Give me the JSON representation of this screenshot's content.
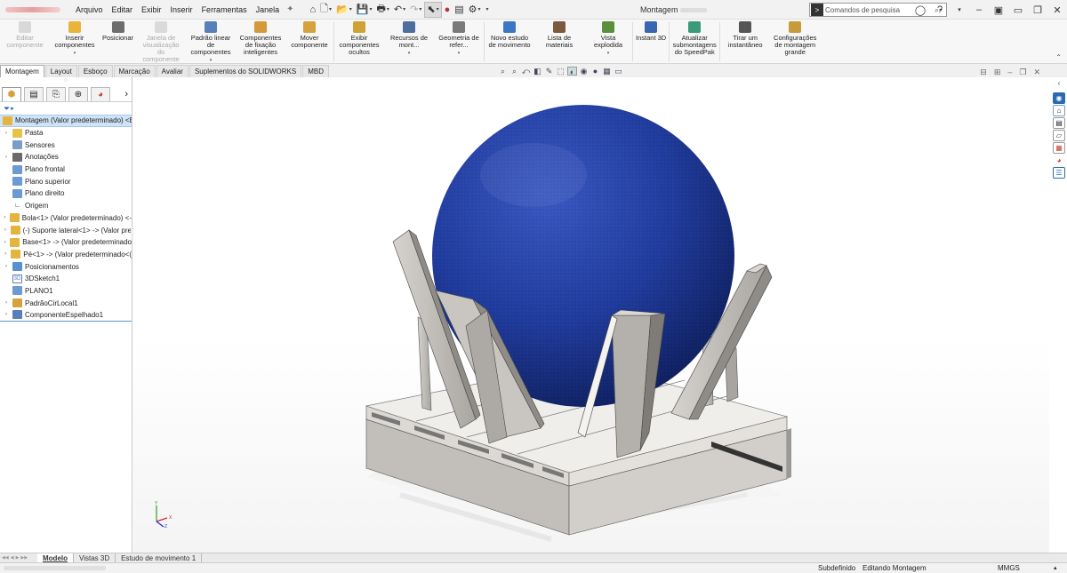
{
  "titlebar": {
    "menu": [
      "Arquivo",
      "Editar",
      "Exibir",
      "Inserir",
      "Ferramentas",
      "Janela"
    ],
    "doc_title": "Montagem",
    "search_placeholder": "Comandos de pesquisa"
  },
  "ribbon": {
    "buttons": [
      {
        "label": "Editar componente",
        "disabled": true,
        "color": "#b9b9b9"
      },
      {
        "label": "Inserir componentes",
        "disabled": false,
        "color": "#e8b43a"
      },
      {
        "label": "Posicionar",
        "disabled": false,
        "color": "#6d6d6d"
      },
      {
        "label": "Janela de visualização do componente",
        "disabled": true,
        "color": "#bdbdbd"
      },
      {
        "label": "Padrão linear de componentes",
        "disabled": false,
        "color": "#5a7fb8"
      },
      {
        "label": "Componentes de fixação inteligentes",
        "disabled": false,
        "color": "#d39a3a"
      },
      {
        "label": "Mover componente",
        "disabled": false,
        "color": "#d6a23d"
      },
      {
        "label": "Exibir componentes ocultos",
        "disabled": false,
        "color": "#cfa236"
      },
      {
        "label": "Recursos de mont...",
        "disabled": false,
        "color": "#4d6f9e"
      },
      {
        "label": "Geometria de refer...",
        "disabled": false,
        "color": "#7a7a7a"
      },
      {
        "label": "Novo estudo de movimento",
        "disabled": false,
        "color": "#3c77c4"
      },
      {
        "label": "Lista de materiais",
        "disabled": false,
        "color": "#7d5a3c"
      },
      {
        "label": "Vista explodida",
        "disabled": false,
        "color": "#5a8f3c"
      },
      {
        "label": "Instant 3D",
        "disabled": false,
        "color": "#3a66b0"
      },
      {
        "label": "Atualizar submontagens do SpeedPak",
        "disabled": false,
        "color": "#3a9a7a"
      },
      {
        "label": "Tirar um instantâneo",
        "disabled": false,
        "color": "#555555"
      },
      {
        "label": "Configurações de montagem grande",
        "disabled": false,
        "color": "#c79b3b"
      }
    ]
  },
  "tabs": [
    "Montagem",
    "Layout",
    "Esboço",
    "Marcação",
    "Avaliar",
    "Suplementos do SOLIDWORKS",
    "MBD"
  ],
  "active_tab": "Montagem",
  "tree": {
    "root": "Montagem (Valor predeterminado) <Es",
    "items": [
      {
        "label": "Pasta",
        "exp": true,
        "icon": "folder-icon",
        "color": "#e6c34a"
      },
      {
        "label": "Sensores",
        "exp": false,
        "icon": "sensor-icon",
        "color": "#7a9ec8"
      },
      {
        "label": "Anotações",
        "exp": true,
        "icon": "annotation-icon",
        "color": "#6a6a6a"
      },
      {
        "label": "Plano frontal",
        "exp": false,
        "icon": "plane-icon",
        "color": "#6b9bd2"
      },
      {
        "label": "Plano superior",
        "exp": false,
        "icon": "plane-icon",
        "color": "#6b9bd2"
      },
      {
        "label": "Plano direito",
        "exp": false,
        "icon": "plane-icon",
        "color": "#6b9bd2"
      },
      {
        "label": "Origem",
        "exp": false,
        "icon": "origin-icon",
        "color": "#333333"
      },
      {
        "label": "Bola<1> (Valor predeterminado) <-",
        "exp": true,
        "icon": "part-icon",
        "color": "#e3b53e"
      },
      {
        "label": "(-) Suporte lateral<1> -> (Valor pre",
        "exp": true,
        "icon": "part-icon",
        "color": "#e3b53e"
      },
      {
        "label": "Base<1> -> (Valor predeterminado",
        "exp": true,
        "icon": "part-icon",
        "color": "#e3b53e"
      },
      {
        "label": "Pé<1> -> (Valor predeterminado<(",
        "exp": true,
        "icon": "part-icon",
        "color": "#e3b53e"
      },
      {
        "label": "Posicionamentos",
        "exp": true,
        "icon": "mate-icon",
        "color": "#5a8fd0"
      },
      {
        "label": "3DSketch1",
        "exp": false,
        "icon": "sketch3d-icon",
        "color": "#5a7fb8"
      },
      {
        "label": "PLANO1",
        "exp": false,
        "icon": "plane-icon",
        "color": "#6b9bd2"
      },
      {
        "label": "PadrãoCirLocal1",
        "exp": true,
        "icon": "pattern-icon",
        "color": "#d6a23d"
      },
      {
        "label": "ComponenteEspelhado1",
        "exp": true,
        "icon": "mirror-icon",
        "color": "#5a7fb8"
      }
    ]
  },
  "bottom_tabs": [
    "Modelo",
    "Vistas 3D",
    "Estudo de movimento 1"
  ],
  "active_bottom_tab": "Modelo",
  "status": {
    "definition": "Subdefinido",
    "mode": "Editando Montagem",
    "units": "MMGS"
  },
  "model": {
    "sphere_color": "#1f3a9e",
    "steel_color": "#b9b6b1"
  }
}
